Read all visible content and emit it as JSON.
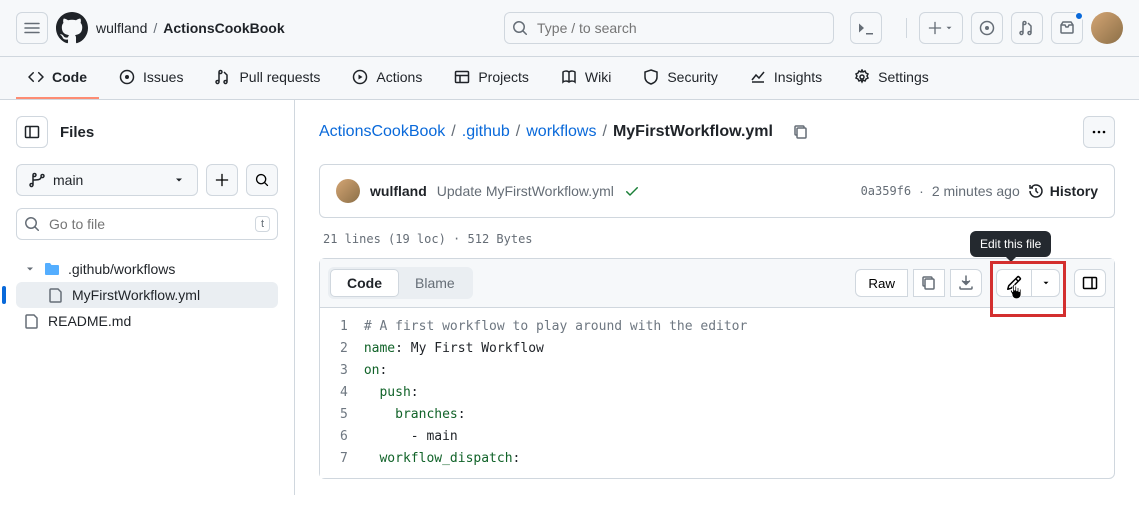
{
  "header": {
    "owner": "wulfland",
    "repo": "ActionsCookBook",
    "search_placeholder": "Type / to search"
  },
  "nav": {
    "items": [
      {
        "label": "Code",
        "icon": "code"
      },
      {
        "label": "Issues",
        "icon": "issue"
      },
      {
        "label": "Pull requests",
        "icon": "pr"
      },
      {
        "label": "Actions",
        "icon": "play"
      },
      {
        "label": "Projects",
        "icon": "table"
      },
      {
        "label": "Wiki",
        "icon": "book"
      },
      {
        "label": "Security",
        "icon": "shield"
      },
      {
        "label": "Insights",
        "icon": "graph"
      },
      {
        "label": "Settings",
        "icon": "gear"
      }
    ]
  },
  "sidebar": {
    "title": "Files",
    "branch": "main",
    "file_search_placeholder": "Go to file",
    "file_search_kbd": "t",
    "tree": {
      "folder": ".github/workflows",
      "file1": "MyFirstWorkflow.yml",
      "file2": "README.md"
    }
  },
  "breadcrumb": {
    "root": "ActionsCookBook",
    "p1": ".github",
    "p2": "workflows",
    "current": "MyFirstWorkflow.yml"
  },
  "commit": {
    "author": "wulfland",
    "message": "Update MyFirstWorkflow.yml",
    "sha": "0a359f6",
    "time": "2 minutes ago",
    "history_label": "History"
  },
  "file_stats": "21 lines (19 loc) · 512 Bytes",
  "file_toolbar": {
    "code_tab": "Code",
    "blame_tab": "Blame",
    "raw": "Raw",
    "tooltip": "Edit this file"
  },
  "code": {
    "lines": [
      {
        "n": "1",
        "t": "comment",
        "txt": "# A first workflow to play around with the editor"
      },
      {
        "n": "2",
        "key": "name",
        "val": " My First Workflow"
      },
      {
        "n": "3",
        "key": "on",
        "val": ""
      },
      {
        "n": "4",
        "indent": "  ",
        "key": "push",
        "val": ""
      },
      {
        "n": "5",
        "indent": "    ",
        "key": "branches",
        "val": ""
      },
      {
        "n": "6",
        "plain": "      - main"
      },
      {
        "n": "7",
        "indent": "  ",
        "key": "workflow_dispatch",
        "val": ""
      }
    ]
  }
}
